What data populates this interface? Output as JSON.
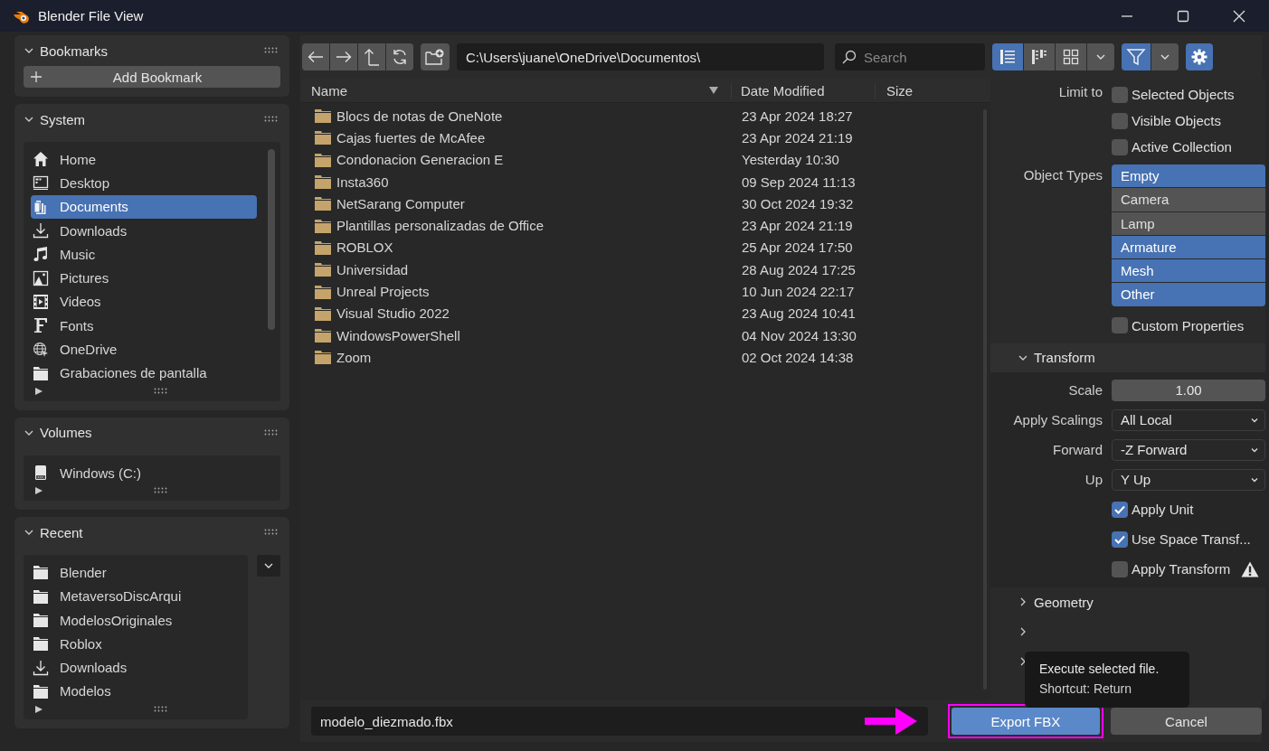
{
  "window": {
    "title": "Blender File View"
  },
  "sidebar": [
    {
      "kind": "button",
      "title": "Bookmarks",
      "expanded": true,
      "button": "Add Bookmark"
    },
    {
      "kind": "list",
      "title": "System",
      "expanded": true,
      "items": [
        {
          "label": "Home",
          "kind": "home",
          "selected": false
        },
        {
          "label": "Desktop",
          "kind": "desktop",
          "selected": false
        },
        {
          "label": "Documents",
          "kind": "documents",
          "selected": true
        },
        {
          "label": "Downloads",
          "kind": "download",
          "selected": false
        },
        {
          "label": "Music",
          "kind": "music",
          "selected": false
        },
        {
          "label": "Pictures",
          "kind": "picture",
          "selected": false
        },
        {
          "label": "Videos",
          "kind": "film",
          "selected": false
        },
        {
          "label": "Fonts",
          "kind": "font",
          "selected": false
        },
        {
          "label": "OneDrive",
          "kind": "globe",
          "selected": false
        },
        {
          "label": "Grabaciones de pantalla",
          "kind": "folder",
          "selected": false
        }
      ]
    },
    {
      "kind": "list",
      "title": "Volumes",
      "expanded": true,
      "items": [
        {
          "label": "Windows (C:)",
          "kind": "drive",
          "selected": false
        }
      ]
    },
    {
      "kind": "recent",
      "title": "Recent",
      "expanded": true,
      "items": [
        {
          "label": "Blender",
          "kind": "folder",
          "selected": false
        },
        {
          "label": "MetaversoDiscArqui",
          "kind": "folder",
          "selected": false
        },
        {
          "label": "ModelosOriginales",
          "kind": "folder",
          "selected": false
        },
        {
          "label": "Roblox",
          "kind": "folder",
          "selected": false
        },
        {
          "label": "Downloads",
          "kind": "download",
          "selected": false
        },
        {
          "label": "Modelos",
          "kind": "folder",
          "selected": false
        }
      ]
    }
  ],
  "toolbar": {
    "path": "C:\\Users\\juane\\OneDrive\\Documentos\\",
    "search": {
      "placeholder": "Search"
    },
    "view_modes": [
      {
        "kind": "list",
        "selected": true
      },
      {
        "kind": "columns",
        "selected": false
      },
      {
        "kind": "grid",
        "selected": false
      }
    ],
    "filter": {
      "on": true
    }
  },
  "file_list": {
    "columns": [
      "Name",
      "Date Modified",
      "Size"
    ],
    "rows": [
      {
        "name": "Blocs de notas de OneNote",
        "date": "23 Apr 2024 18:27"
      },
      {
        "name": "Cajas fuertes de McAfee",
        "date": "23 Apr 2024 21:19"
      },
      {
        "name": "Condonacion Generacion E",
        "date": "Yesterday 10:30"
      },
      {
        "name": "Insta360",
        "date": "09 Sep 2024 11:13"
      },
      {
        "name": "NetSarang Computer",
        "date": "30 Oct 2024 19:32"
      },
      {
        "name": "Plantillas personalizadas de Office",
        "date": "23 Apr 2024 21:19"
      },
      {
        "name": "ROBLOX",
        "date": "25 Apr 2024 17:50"
      },
      {
        "name": "Universidad",
        "date": "28 Aug 2024 17:25"
      },
      {
        "name": "Unreal Projects",
        "date": "10 Jun 2024 22:17"
      },
      {
        "name": "Visual Studio 2022",
        "date": "23 Aug 2024 10:41"
      },
      {
        "name": "WindowsPowerShell",
        "date": "04 Nov 2024 13:30"
      },
      {
        "name": "Zoom",
        "date": "02 Oct 2024 14:38"
      }
    ]
  },
  "properties": {
    "limit_to": {
      "label": "Limit to",
      "options": [
        {
          "label": "Selected Objects",
          "checked": false
        },
        {
          "label": "Visible Objects",
          "checked": false
        },
        {
          "label": "Active Collection",
          "checked": false
        }
      ]
    },
    "object_types": {
      "label": "Object Types",
      "items": [
        {
          "label": "Empty",
          "selected": true
        },
        {
          "label": "Camera",
          "selected": false
        },
        {
          "label": "Lamp",
          "selected": false
        },
        {
          "label": "Armature",
          "selected": true
        },
        {
          "label": "Mesh",
          "selected": true
        },
        {
          "label": "Other",
          "selected": true
        }
      ]
    },
    "custom_properties": {
      "label": "Custom Properties",
      "checked": false
    },
    "transform": {
      "title": "Transform",
      "expanded": true,
      "fields": [
        {
          "kind": "number",
          "label": "Scale",
          "value": "1.00"
        },
        {
          "kind": "dropdown",
          "label": "Apply Scalings",
          "value": "All Local"
        },
        {
          "kind": "dropdown",
          "label": "Forward",
          "value": "-Z Forward"
        },
        {
          "kind": "dropdown",
          "label": "Up",
          "value": "Y Up"
        }
      ],
      "options": [
        {
          "label": "Apply Unit",
          "checked": true,
          "warning": false
        },
        {
          "label": "Use Space Transf...",
          "checked": true,
          "warning": false
        },
        {
          "label": "Apply Transform",
          "checked": false,
          "warning": true
        }
      ]
    },
    "sections": [
      {
        "title": "Geometry",
        "expanded": false
      },
      {
        "expanded": false
      },
      {
        "expanded": false
      }
    ]
  },
  "bottom": {
    "filename": "modelo_diezmado.fbx",
    "export": {
      "label": "Export FBX",
      "highlighted": true
    },
    "cancel": "Cancel"
  },
  "tooltip": {
    "lines": [
      "Execute selected file.",
      "Shortcut: Return"
    ]
  }
}
